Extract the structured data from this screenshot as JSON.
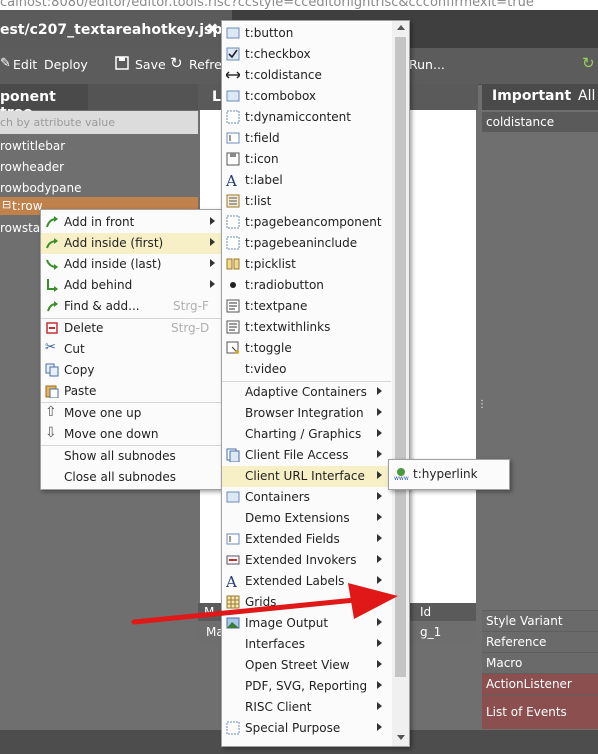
{
  "browser": {
    "url_fragment": "calhost:8080/editor/editor.tools.risc?ccstyle=cceditorlightrisc&ccconfirmexit=true"
  },
  "tab": {
    "title": "est/c207_textareahotkey.jsp",
    "close": "✖"
  },
  "toolbar": {
    "edit": "Edit",
    "deploy": "Deploy",
    "save": "Save",
    "refresh": "Refre",
    "run": "Run..."
  },
  "tree": {
    "header": "ponent tree",
    "search_placeholder": "ch by attribute value",
    "items": [
      "rowtitlebar",
      "rowheader",
      "rowbodypane",
      "t:row",
      "rowstat"
    ]
  },
  "center": {
    "header": "L",
    "bottom_header_left": "M",
    "bottom_header_id": "Id",
    "bottom_row_left": "Ma",
    "bottom_row_id": "g_1"
  },
  "right": {
    "tab_important": "Important",
    "tab_all": "All",
    "selected": "coldistance",
    "props": [
      "Style Variant",
      "Reference",
      "Macro",
      "ActionListener",
      "List of Events"
    ]
  },
  "context_menu": {
    "items": [
      {
        "label": "Add in front",
        "submenu": true
      },
      {
        "label": "Add inside (first)",
        "submenu": true,
        "highlight": true
      },
      {
        "label": "Add inside (last)",
        "submenu": true
      },
      {
        "label": "Add behind",
        "submenu": true
      },
      {
        "label": "Find & add...",
        "shortcut": "Strg-F"
      },
      {
        "label": "Delete",
        "shortcut": "Strg-D"
      },
      {
        "label": "Cut"
      },
      {
        "label": "Copy"
      },
      {
        "label": "Paste"
      },
      {
        "label": "Move one up"
      },
      {
        "label": "Move one down"
      },
      {
        "label": "Show all subnodes"
      },
      {
        "label": "Close all subnodes"
      }
    ]
  },
  "component_menu": {
    "items": [
      "t:button",
      "t:checkbox",
      "t:coldistance",
      "t:combobox",
      "t:dynamiccontent",
      "t:field",
      "t:icon",
      "t:label",
      "t:list",
      "t:pagebeancomponent",
      "t:pagebeaninclude",
      "t:picklist",
      "t:radiobutton",
      "t:textpane",
      "t:textwithlinks",
      "t:toggle",
      "t:video"
    ],
    "categories": [
      "Adaptive Containers",
      "Browser Integration",
      "Charting / Graphics",
      "Client File Access",
      "Client URL Interface",
      "Containers",
      "Demo Extensions",
      "Extended Fields",
      "Extended Invokers",
      "Extended Labels",
      "Grids",
      "Image Output",
      "Interfaces",
      "Open Street View",
      "PDF, SVG, Reporting",
      "RISC Client",
      "Special Purpose"
    ]
  },
  "submenu": {
    "item": "t:hyperlink"
  },
  "colors": {
    "accent_orange": "#c0814b",
    "highlight": "#f7f0c6",
    "arrow_red": "#e01818",
    "list_of_events_bg": "#8b4f4f"
  }
}
